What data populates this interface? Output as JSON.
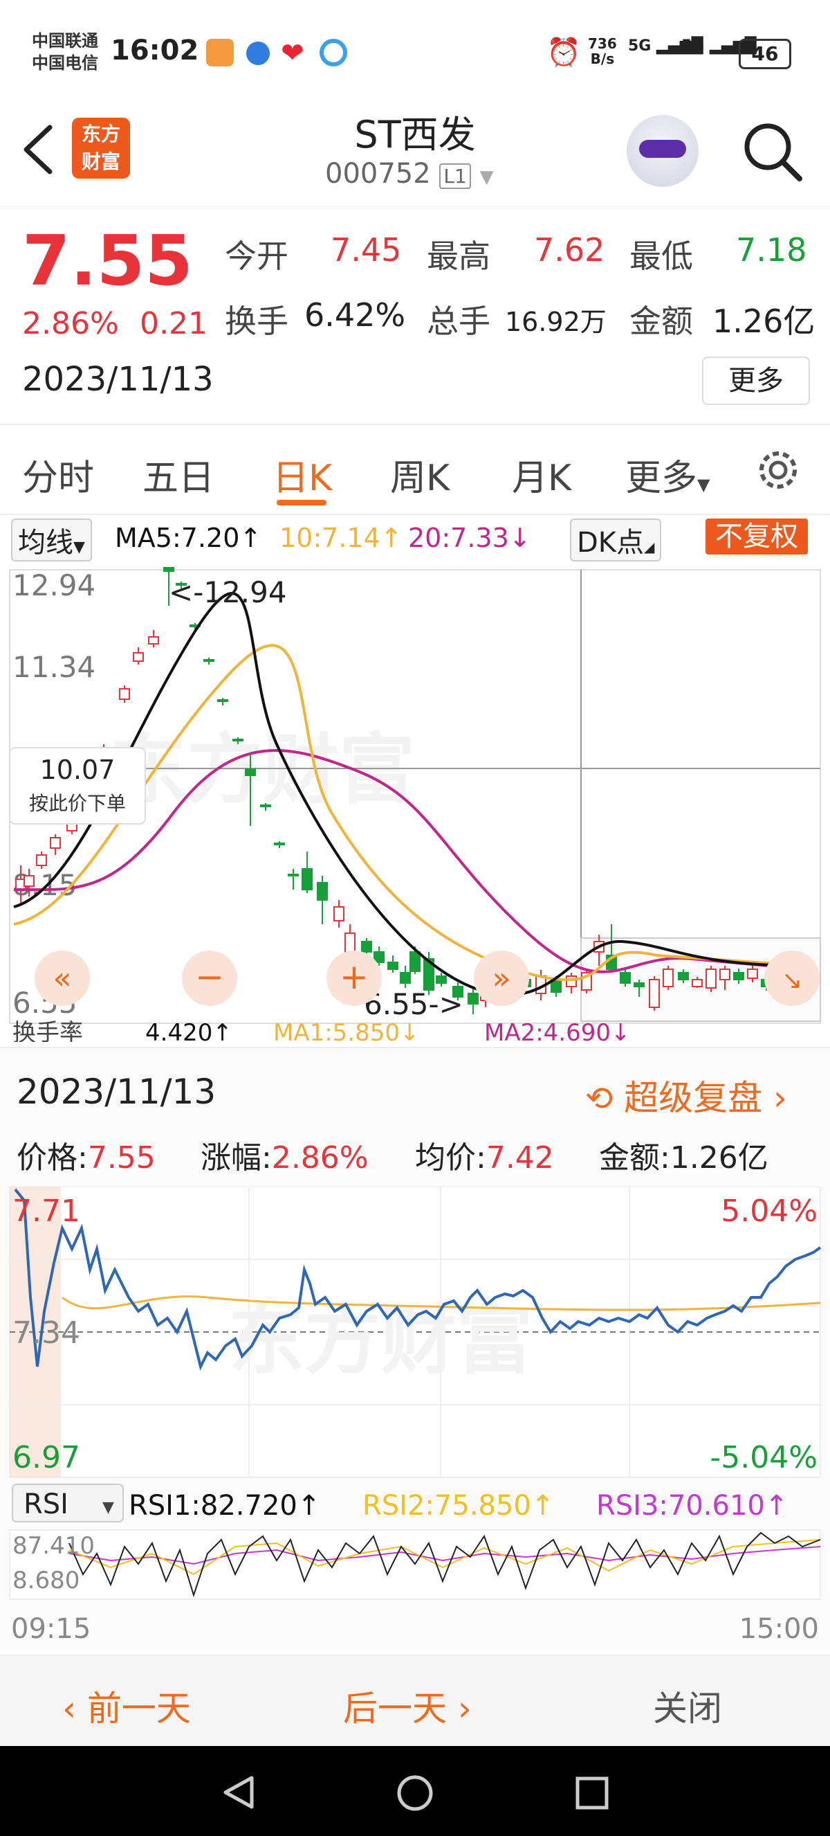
{
  "status": {
    "carrier1": "中国联通",
    "carrier2": "中国电信",
    "time": "16:02",
    "net_speed_top": "736",
    "net_speed_bottom": "B/s",
    "sig1": "5G",
    "sig2": "5G",
    "battery": "46"
  },
  "header": {
    "logo_line1": "东方",
    "logo_line2": "财富",
    "title": "ST西发",
    "code": "000752",
    "level": "L1"
  },
  "quote": {
    "price": "7.55",
    "change_pct": "2.86%",
    "change_abs": "0.21",
    "date": "2023/11/13",
    "open_label": "今开",
    "open": "7.45",
    "high_label": "最高",
    "high": "7.62",
    "low_label": "最低",
    "low": "7.18",
    "turnover_label": "换手",
    "turnover": "6.42%",
    "volume_label": "总手",
    "volume": "16.92万",
    "amount_label": "金额",
    "amount": "1.26亿",
    "more": "更多"
  },
  "tabs": [
    "分时",
    "五日",
    "日K",
    "周K",
    "月K",
    "更多"
  ],
  "ma_bar": {
    "select": "均线",
    "ma5": "MA5:7.20↑",
    "ma10": "10:7.14↑",
    "ma20": "20:7.33↓",
    "dk": "DK点",
    "adjust": "不复权"
  },
  "kline": {
    "ticks": [
      "12.94",
      "11.34",
      "8.15",
      "6.55"
    ],
    "max_label": "<-12.94",
    "min_label": "6.55->",
    "crosshair_value": "10.07",
    "crosshair_action": "按此价下单",
    "sub_indicator": "换手率",
    "sub_ma1": "MA1:5.850↓",
    "sub_ma2": "MA2:4.690↓",
    "sub_value": "4.420↑"
  },
  "intraday": {
    "date": "2023/11/13",
    "replay": "超级复盘",
    "price_label": "价格:",
    "price": "7.55",
    "chg_label": "涨幅:",
    "chg": "2.86%",
    "avg_label": "均价:",
    "avg": "7.42",
    "amt_label": "金额:",
    "amt": "1.26亿",
    "top": "7.71",
    "mid": "7.34",
    "bottom": "6.97",
    "top_pct": "5.04%",
    "bottom_pct": "-5.04%",
    "rsi_select": "RSI",
    "rsi1": "RSI1:82.720↑",
    "rsi2": "RSI2:75.850↑",
    "rsi3": "RSI3:70.610↑",
    "rsi_top": "87.410",
    "rsi_bottom": "8.680",
    "time_start": "09:15",
    "time_end": "15:00"
  },
  "footer": {
    "prev": "前一天",
    "next": "后一天",
    "close": "关闭"
  },
  "colors": {
    "up": "#e8333a",
    "down": "#17a03a",
    "accent": "#ee6a1e",
    "ma5": "#111111",
    "ma10": "#f0b43c",
    "ma20": "#c0268c"
  }
}
